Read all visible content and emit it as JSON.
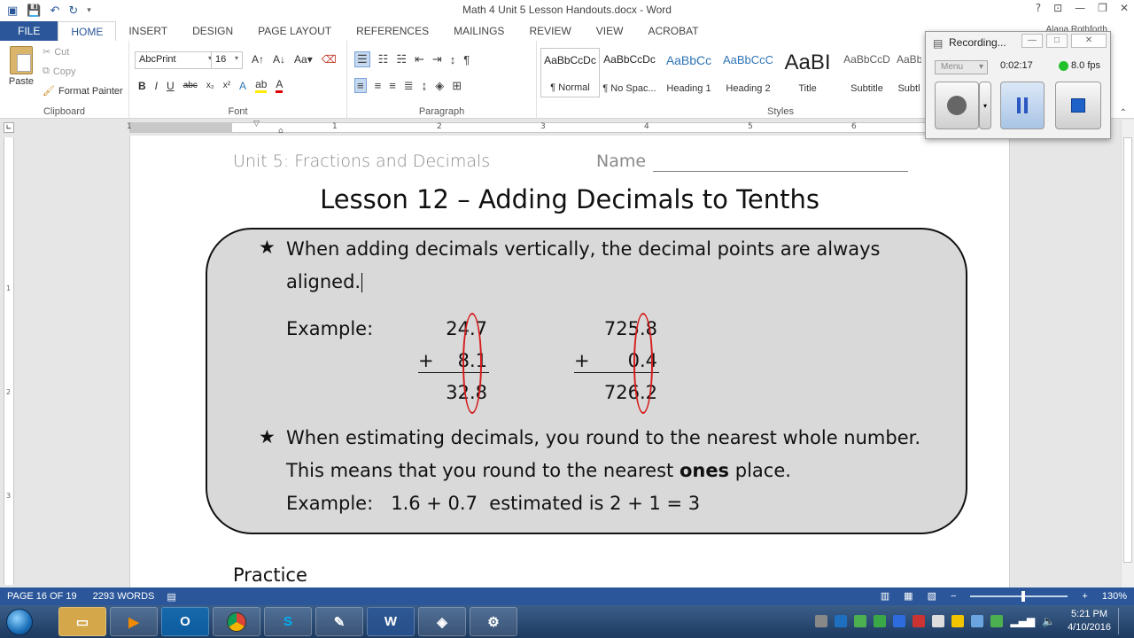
{
  "window": {
    "title": "Math 4 Unit 5 Lesson Handouts.docx - Word",
    "user": "Alana Rothforth"
  },
  "tabs": [
    "FILE",
    "HOME",
    "INSERT",
    "DESIGN",
    "PAGE LAYOUT",
    "REFERENCES",
    "MAILINGS",
    "REVIEW",
    "VIEW",
    "ACROBAT"
  ],
  "ribbon": {
    "clipboard": {
      "paste": "Paste",
      "cut": "Cut",
      "copy": "Copy",
      "format_painter": "Format Painter",
      "label": "Clipboard"
    },
    "font": {
      "name": "AbcPrint",
      "size": "16",
      "label": "Font"
    },
    "paragraph": {
      "label": "Paragraph"
    },
    "styles": {
      "label": "Styles",
      "items": [
        {
          "preview": "AaBbCcDc",
          "name": "¶ Normal"
        },
        {
          "preview": "AaBbCcDc",
          "name": "¶ No Spac..."
        },
        {
          "preview": "AaBbCc",
          "name": "Heading 1"
        },
        {
          "preview": "AaBbCcC",
          "name": "Heading 2"
        },
        {
          "preview": "AaBI",
          "name": "Title"
        },
        {
          "preview": "AaBbCcD",
          "name": "Subtitle"
        },
        {
          "preview": "AaBbCcD",
          "name": "Subtl"
        }
      ]
    }
  },
  "ruler": {
    "numbers": [
      "1",
      "1",
      "2",
      "3",
      "4",
      "5",
      "6"
    ],
    "vnumbers": [
      "1",
      "2",
      "3"
    ]
  },
  "document": {
    "unit_header": "Unit 5: Fractions and Decimals",
    "name_label": "Name",
    "lesson_title": "Lesson 12 – Adding Decimals to Tenths",
    "bullet1_line1": "When adding decimals vertically, the decimal points are always",
    "bullet1_line2": "aligned.",
    "example_label": "Example:",
    "example1": {
      "a": "24.7",
      "op": "+",
      "b": "8.1",
      "sum": "32.8"
    },
    "example2": {
      "a": "725.8",
      "op": "+",
      "b": "0.4",
      "sum": "726.2"
    },
    "bullet2_line1": "When estimating decimals, you round to the nearest whole number.",
    "bullet2_line2_pre": "This means that you round to the nearest ",
    "bullet2_line2_bold": "ones",
    "bullet2_line2_post": " place.",
    "bullet2_line3": "Example:   1.6 + 0.7  estimated is 2 + 1 = 3",
    "practice": "Practice",
    "bullet_symbol": "★"
  },
  "status": {
    "page": "PAGE 16 OF 19",
    "words": "2293 WORDS",
    "zoom": "130%"
  },
  "recorder": {
    "title": "Recording...",
    "menu": "Menu",
    "time": "0:02:17",
    "fps": "8.0 fps"
  },
  "taskbar": {
    "time": "5:21 PM",
    "date": "4/10/2016"
  },
  "colors": {
    "accent": "#2b579a",
    "oval": "#d61b1b",
    "box_fill": "#d9d9d9"
  }
}
